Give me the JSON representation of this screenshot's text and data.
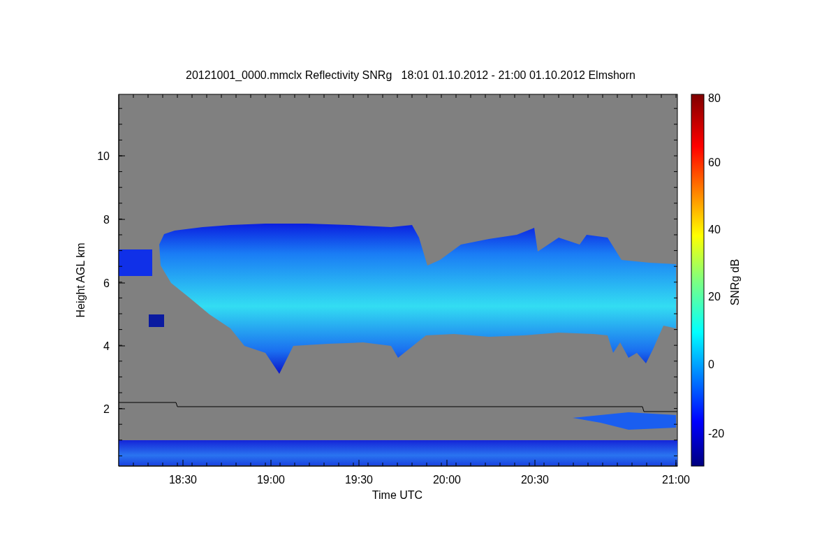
{
  "title": "20121001_0000.mmclx Reflectivity SNRg   18:01 01.10.2012 - 21:00 01.10.2012 Elmshorn",
  "y_axis": {
    "label": "Height AGL km",
    "ticks": [
      "10",
      "8",
      "6",
      "4",
      "2"
    ]
  },
  "x_axis": {
    "label": "Time UTC",
    "ticks": [
      "18:30",
      "19:00",
      "19:30",
      "20:00",
      "20:30",
      "21:00"
    ]
  },
  "colorbar": {
    "label": "SNRg dB",
    "ticks": [
      "80",
      "60",
      "40",
      "20",
      "0",
      "-20"
    ]
  }
}
